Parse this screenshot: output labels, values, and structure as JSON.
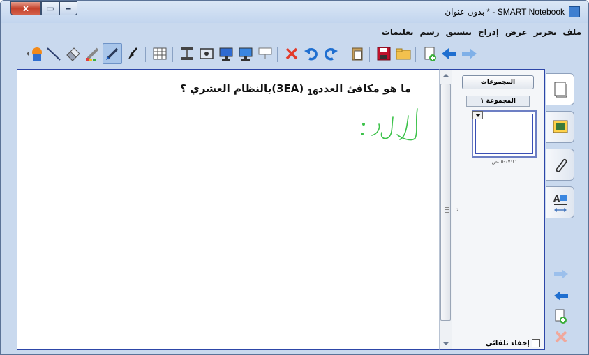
{
  "window": {
    "title": "بدون عنوان * - SMART Notebook",
    "controls": {
      "close": "x",
      "maximize": "▭",
      "minimize": "‒"
    }
  },
  "menu": [
    "ملف",
    "تحرير",
    "عرض",
    "إدراج",
    "تنسيق",
    "رسم",
    "تعليمات"
  ],
  "canvas": {
    "question_prefix": "ما هو مكافئ العدد",
    "question_subscript": "16",
    "question_number": "(3EA)",
    "question_suffix": "بالنظام العشري ؟",
    "handwriting_text": "الحل:",
    "handwriting_color": "#3cc24a"
  },
  "side_panel": {
    "groups_button": "المجموعات",
    "group_label": "المجموعة ١",
    "page_time": "٠٧:١١-٥ ،ص",
    "autohide_label": "إخفاء تلقائي"
  },
  "colors": {
    "window_bg": "#c9d9ee",
    "canvas_border": "#2d46a8",
    "accent_blue": "#1f6fd0"
  }
}
